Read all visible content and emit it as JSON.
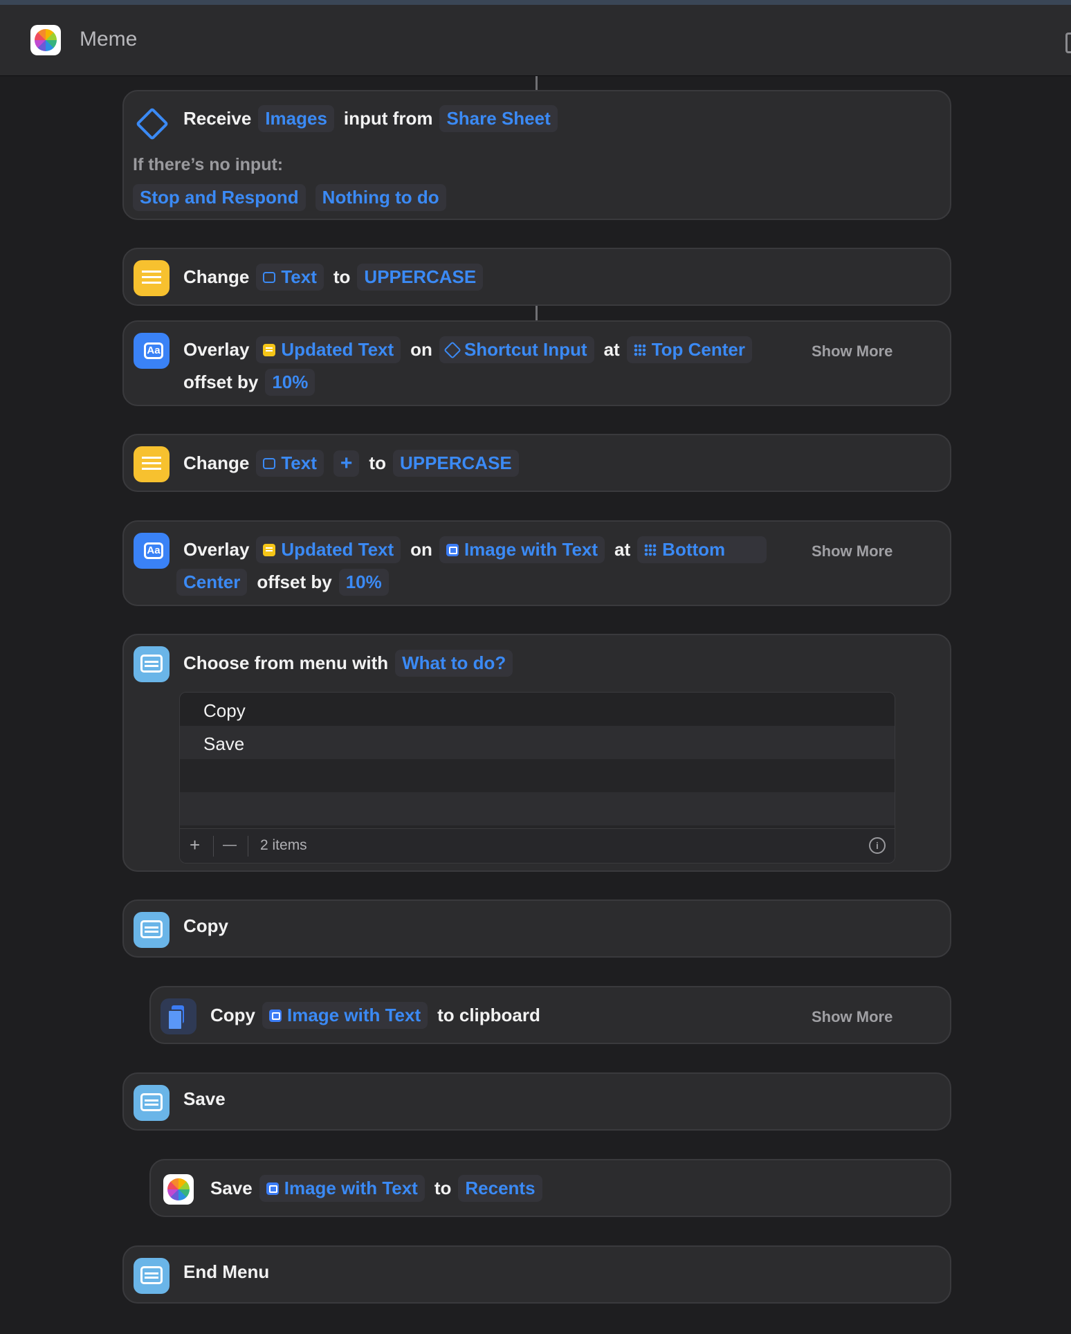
{
  "window": {
    "title": "Meme"
  },
  "actions": {
    "receive": {
      "w1": "Receive",
      "t1": "Images",
      "w2": "input from",
      "t2": "Share Sheet",
      "no_input_label": "If there’s no input:",
      "t3": "Stop and Respond",
      "t4": "Nothing to do"
    },
    "change1": {
      "w1": "Change",
      "t1": "Text",
      "w2": "to",
      "t2": "UPPERCASE"
    },
    "overlay1": {
      "w1": "Overlay",
      "t1": "Updated Text",
      "w2": "on",
      "t2": "Shortcut Input",
      "w3": "at",
      "t3": "Top Center",
      "w4": "offset by",
      "t4": "10%",
      "show_more": "Show More"
    },
    "change2": {
      "w1": "Change",
      "t1": "Text",
      "plus": "+",
      "w2": "to",
      "t2": "UPPERCASE"
    },
    "overlay2": {
      "w1": "Overlay",
      "t1": "Updated Text",
      "w2": "on",
      "t2": "Image with Text",
      "w3": "at",
      "t3a": "Bottom",
      "t3b": "Center",
      "w4": "offset by",
      "t4": "10%",
      "show_more": "Show More"
    },
    "menu": {
      "w1": "Choose from menu with",
      "t1": "What to do?",
      "items": [
        "Copy",
        "Save"
      ],
      "footer": {
        "add": "+",
        "remove": "—",
        "count": "2 items",
        "info": "i"
      }
    },
    "copy_case": {
      "label": "Copy"
    },
    "copy_clip": {
      "w1": "Copy",
      "t1": "Image with Text",
      "w2": "to clipboard",
      "show_more": "Show More"
    },
    "save_case": {
      "label": "Save"
    },
    "save_photos": {
      "w1": "Save",
      "t1": "Image with Text",
      "w2": "to",
      "t2": "Recents"
    },
    "end_menu": {
      "label": "End Menu"
    }
  },
  "colors": {
    "accent": "#3b8af5",
    "card_bg": "#2c2c2e",
    "page_bg": "#1e1e20"
  }
}
